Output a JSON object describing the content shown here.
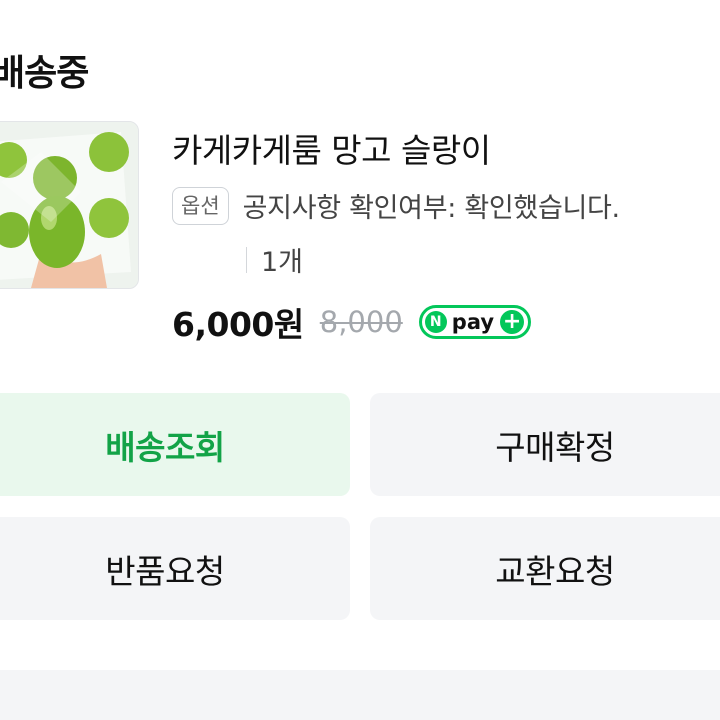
{
  "order": {
    "status": "배송중",
    "product": {
      "thumbnail_icon": "product-thumbnail-green-balls",
      "title": "카게카게룸 망고 슬랑이",
      "option_badge": "옵션",
      "option_text": "공지사항 확인여부: 확인했습니다.",
      "quantity": "1개",
      "price": "6,000원",
      "original_price": "8,000",
      "npay_badge": {
        "n": "N",
        "text": "pay",
        "plus": "+",
        "color": "#03c75a"
      }
    }
  },
  "actions": {
    "track_delivery": "배송조회",
    "confirm_purchase": "구매확정",
    "request_return": "반품요청",
    "request_exchange": "교환요청"
  },
  "colors": {
    "accent_green": "#12a347",
    "primary_button_bg": "#e9f8ed",
    "button_bg": "#f4f5f7"
  }
}
